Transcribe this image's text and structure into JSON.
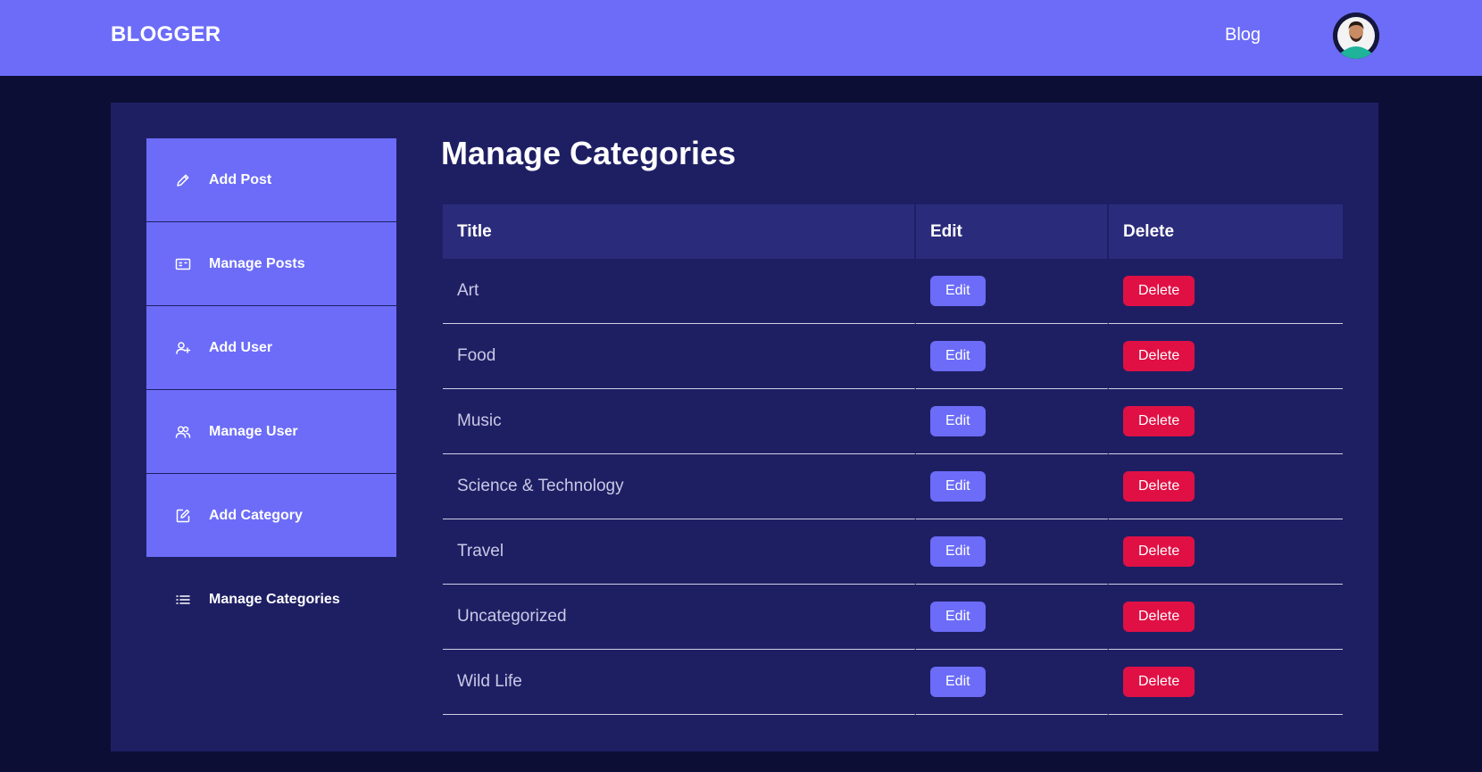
{
  "header": {
    "brand": "BLOGGER",
    "nav_blog": "Blog"
  },
  "sidebar": {
    "items": [
      {
        "label": "Add Post",
        "icon": "pencil-icon"
      },
      {
        "label": "Manage Posts",
        "icon": "posts-card-icon"
      },
      {
        "label": "Add User",
        "icon": "user-add-icon"
      },
      {
        "label": "Manage User",
        "icon": "users-icon"
      },
      {
        "label": "Add Category",
        "icon": "edit-square-icon"
      },
      {
        "label": "Manage Categories",
        "icon": "list-icon",
        "active": true
      }
    ]
  },
  "main": {
    "title": "Manage Categories",
    "table": {
      "headers": [
        "Title",
        "Edit",
        "Delete"
      ],
      "rows": [
        {
          "title": "Art",
          "edit": "Edit",
          "delete": "Delete"
        },
        {
          "title": "Food",
          "edit": "Edit",
          "delete": "Delete"
        },
        {
          "title": "Music",
          "edit": "Edit",
          "delete": "Delete"
        },
        {
          "title": "Science & Technology",
          "edit": "Edit",
          "delete": "Delete"
        },
        {
          "title": "Travel",
          "edit": "Edit",
          "delete": "Delete"
        },
        {
          "title": "Uncategorized",
          "edit": "Edit",
          "delete": "Delete"
        },
        {
          "title": "Wild Life",
          "edit": "Edit",
          "delete": "Delete"
        }
      ]
    }
  },
  "colors": {
    "accent": "#6c6cf8",
    "panel": "#1e1f63",
    "background": "#0c0e35",
    "danger": "#e01045"
  }
}
